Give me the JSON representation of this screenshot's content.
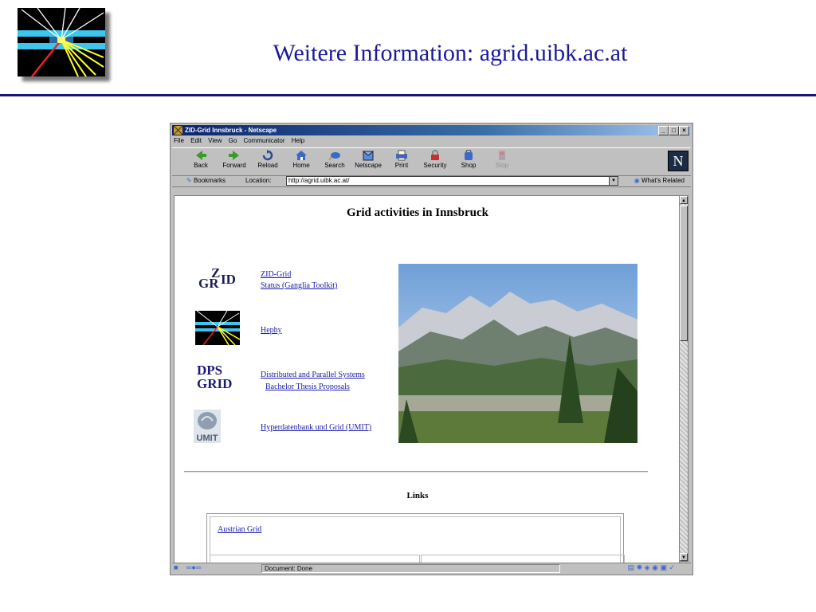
{
  "slide": {
    "title": "Weitere Information: agrid.uibk.ac.at",
    "logo_icon": "particle-collision-logo"
  },
  "browser": {
    "window_title": "ZID-Grid Innsbruck - Netscape",
    "menu": [
      "File",
      "Edit",
      "View",
      "Go",
      "Communicator",
      "Help"
    ],
    "nav_buttons": [
      {
        "label": "Back",
        "icon": "back-arrow-icon"
      },
      {
        "label": "Forward",
        "icon": "forward-arrow-icon"
      },
      {
        "label": "Reload",
        "icon": "reload-icon"
      },
      {
        "label": "Home",
        "icon": "home-icon"
      },
      {
        "label": "Search",
        "icon": "search-icon"
      },
      {
        "label": "Netscape",
        "icon": "netscape-icon"
      },
      {
        "label": "Print",
        "icon": "print-icon"
      },
      {
        "label": "Security",
        "icon": "security-icon"
      },
      {
        "label": "Shop",
        "icon": "shop-icon"
      },
      {
        "label": "Stop",
        "icon": "stop-icon"
      }
    ],
    "netscape_logo": "N",
    "bookmarks_label": "Bookmarks",
    "location_label": "Location:",
    "location_url": "http://agrid.uibk.ac.at/",
    "whats_related": "What's Related",
    "status_text": "Document: Done",
    "colors": {
      "title_bar": "#0a246a",
      "chrome": "#c0c0c0",
      "link": "#1a1aaa"
    }
  },
  "page": {
    "heading": "Grid activities in Innsbruck",
    "zid_logo": {
      "top": "Z",
      "left": "GR",
      "right": "ID"
    },
    "dps_logo": {
      "line1": "DPS",
      "line2": "GRID"
    },
    "umit_logo": "UMIT",
    "links": {
      "zid_grid": "ZID-Grid",
      "status": "Status (Ganglia Toolkit)",
      "hephy": "Hephy",
      "dps": "Distributed and Parallel Systems",
      "bachelor": "Bachelor Thesis Proposals",
      "umit": "Hyperdatenbank und Grid (UMIT)"
    },
    "links_heading": "Links",
    "austrian_grid": "Austrian Grid",
    "photo": "mountain-landscape-photo"
  }
}
